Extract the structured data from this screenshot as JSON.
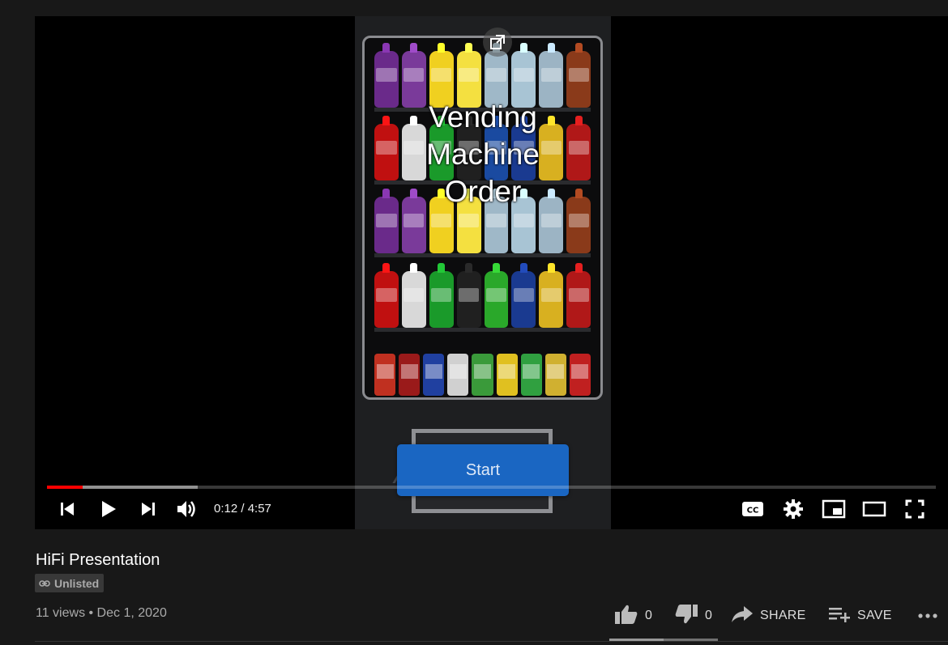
{
  "video": {
    "overlay_title_lines": [
      "Vending",
      "Machine",
      "Order"
    ],
    "start_button_label": "Start",
    "watermark_text": "A         g",
    "progress": {
      "played_fraction": 0.04,
      "loaded_fraction": 0.17
    },
    "time_display": "0:12 / 4:57",
    "icons": [
      "popout-icon",
      "previous-icon",
      "play-icon",
      "next-icon",
      "volume-icon",
      "captions-icon",
      "settings-icon",
      "miniplayer-icon",
      "theater-icon",
      "fullscreen-icon"
    ],
    "colors": {
      "progress_played": "#ff0000",
      "start_button": "#1a66c2",
      "background": "#000000"
    }
  },
  "info": {
    "title": "HiFi Presentation",
    "visibility_badge": "Unlisted",
    "meta": "11 views • Dec 1, 2020"
  },
  "actions": {
    "like_count": "0",
    "dislike_count": "0",
    "share_label": "SHARE",
    "save_label": "SAVE",
    "like_ratio_fraction": 0.5
  },
  "theme": {
    "page_background": "#181818",
    "secondary_text": "#aaaaaa"
  }
}
